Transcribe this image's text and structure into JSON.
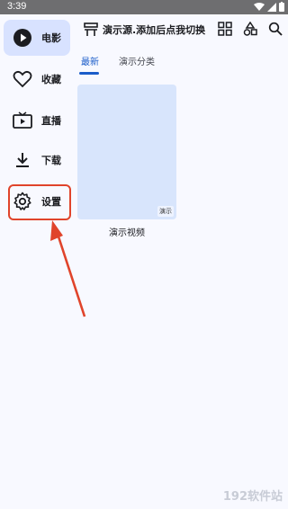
{
  "status_bar": {
    "time": "3:39"
  },
  "nav": {
    "items": [
      {
        "label": "电影",
        "icon": "play-circle-icon",
        "active": true
      },
      {
        "label": "收藏",
        "icon": "heart-icon",
        "active": false
      },
      {
        "label": "直播",
        "icon": "tv-icon",
        "active": false
      },
      {
        "label": "下载",
        "icon": "download-icon",
        "active": false
      },
      {
        "label": "设置",
        "icon": "gear-icon",
        "active": false
      }
    ]
  },
  "header": {
    "title": "演示源.添加后点我切换",
    "actions": [
      "grid-icon",
      "shapes-icon",
      "search-icon"
    ]
  },
  "tabs": [
    {
      "label": "最新",
      "active": true
    },
    {
      "label": "演示分类",
      "active": false
    }
  ],
  "cards": [
    {
      "title": "演示视频",
      "badge": "演示"
    }
  ],
  "colors": {
    "accent": "#1a5cc9",
    "active_nav_bg": "#d8e2ff",
    "highlight": "#e0442b",
    "card_bg": "#d8e5fc"
  },
  "watermark": "192软件站"
}
